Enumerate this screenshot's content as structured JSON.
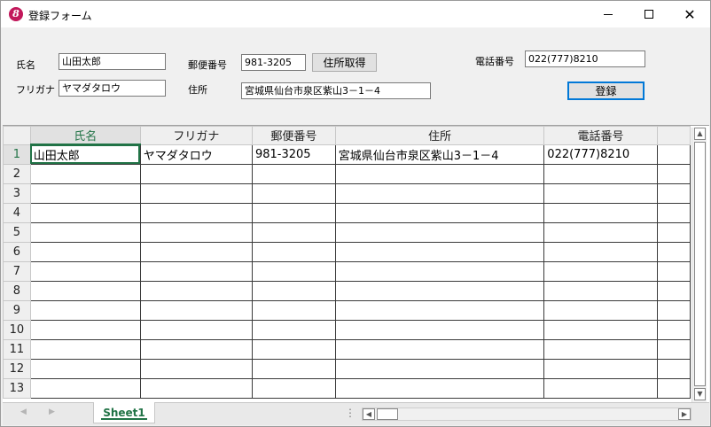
{
  "window": {
    "title": "登録フォーム",
    "app_icon": "8",
    "minimize_glyph": "",
    "close_glyph": "✕"
  },
  "form": {
    "name_label": "氏名",
    "name_value": "山田太郎",
    "kana_label": "フリガナ",
    "kana_value": "ヤマダタロウ",
    "zip_label": "郵便番号",
    "zip_value": "981-3205",
    "address_fetch_button": "住所取得",
    "address_label": "住所",
    "address_value": "宮城県仙台市泉区紫山3－1－4",
    "phone_label": "電話番号",
    "phone_value": "022(777)8210",
    "register_button": "登録"
  },
  "sheet": {
    "columns": [
      "氏名",
      "フリガナ",
      "郵便番号",
      "住所",
      "電話番号"
    ],
    "row_numbers": [
      "1",
      "2",
      "3",
      "4",
      "5",
      "6",
      "7",
      "8",
      "9",
      "10",
      "11",
      "12",
      "13"
    ],
    "rows": [
      [
        "山田太郎",
        "ヤマダタロウ",
        "981-3205",
        "宮城県仙台市泉区紫山3－1－4",
        "022(777)8210"
      ]
    ],
    "tab_name": "Sheet1",
    "nav_prev": "◀",
    "nav_next": "▶",
    "split_glyph": "⋮"
  },
  "colors": {
    "accent": "#217346",
    "app_icon": "#c2185b",
    "focus_border": "#0078d7"
  }
}
